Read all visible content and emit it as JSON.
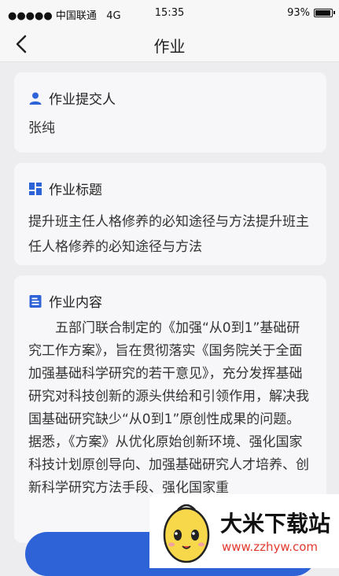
{
  "status_bar": {
    "carrier": "●●●●● 中国联通",
    "network": "4G",
    "time": "15:35",
    "battery": "93%"
  },
  "nav": {
    "title": "作业"
  },
  "submitter": {
    "label": "作业提交人",
    "icon": "person-icon",
    "value": "张纯"
  },
  "homework_title": {
    "label": "作业标题",
    "icon": "grid-icon",
    "value": "提升班主任人格修养的必知途径与方法提升班主任人格修养的必知途径与方法"
  },
  "homework_content": {
    "label": "作业内容",
    "icon": "document-icon",
    "value": "五部门联合制定的《加强“从0到1”基础研究工作方案》，旨在贯彻落实《国务院关于全面加强基础科学研究的若干意见》，充分发挥基础研究对科技创新的源头供给和引领作用，解决我国基础研究缺少“从0到1”原创性成果的问题。据悉，《方案》从优化原始创新环境、强化国家科技计划原创导向、加强基础研究人才培养、创新科学研究方法手段、强化国家重"
  },
  "watermark": {
    "brand": "大米下载站",
    "url": "www.zzhyw.com"
  },
  "colors": {
    "accent": "#2e63d8",
    "background": "#ededf0",
    "card": "#f7f7f9"
  }
}
